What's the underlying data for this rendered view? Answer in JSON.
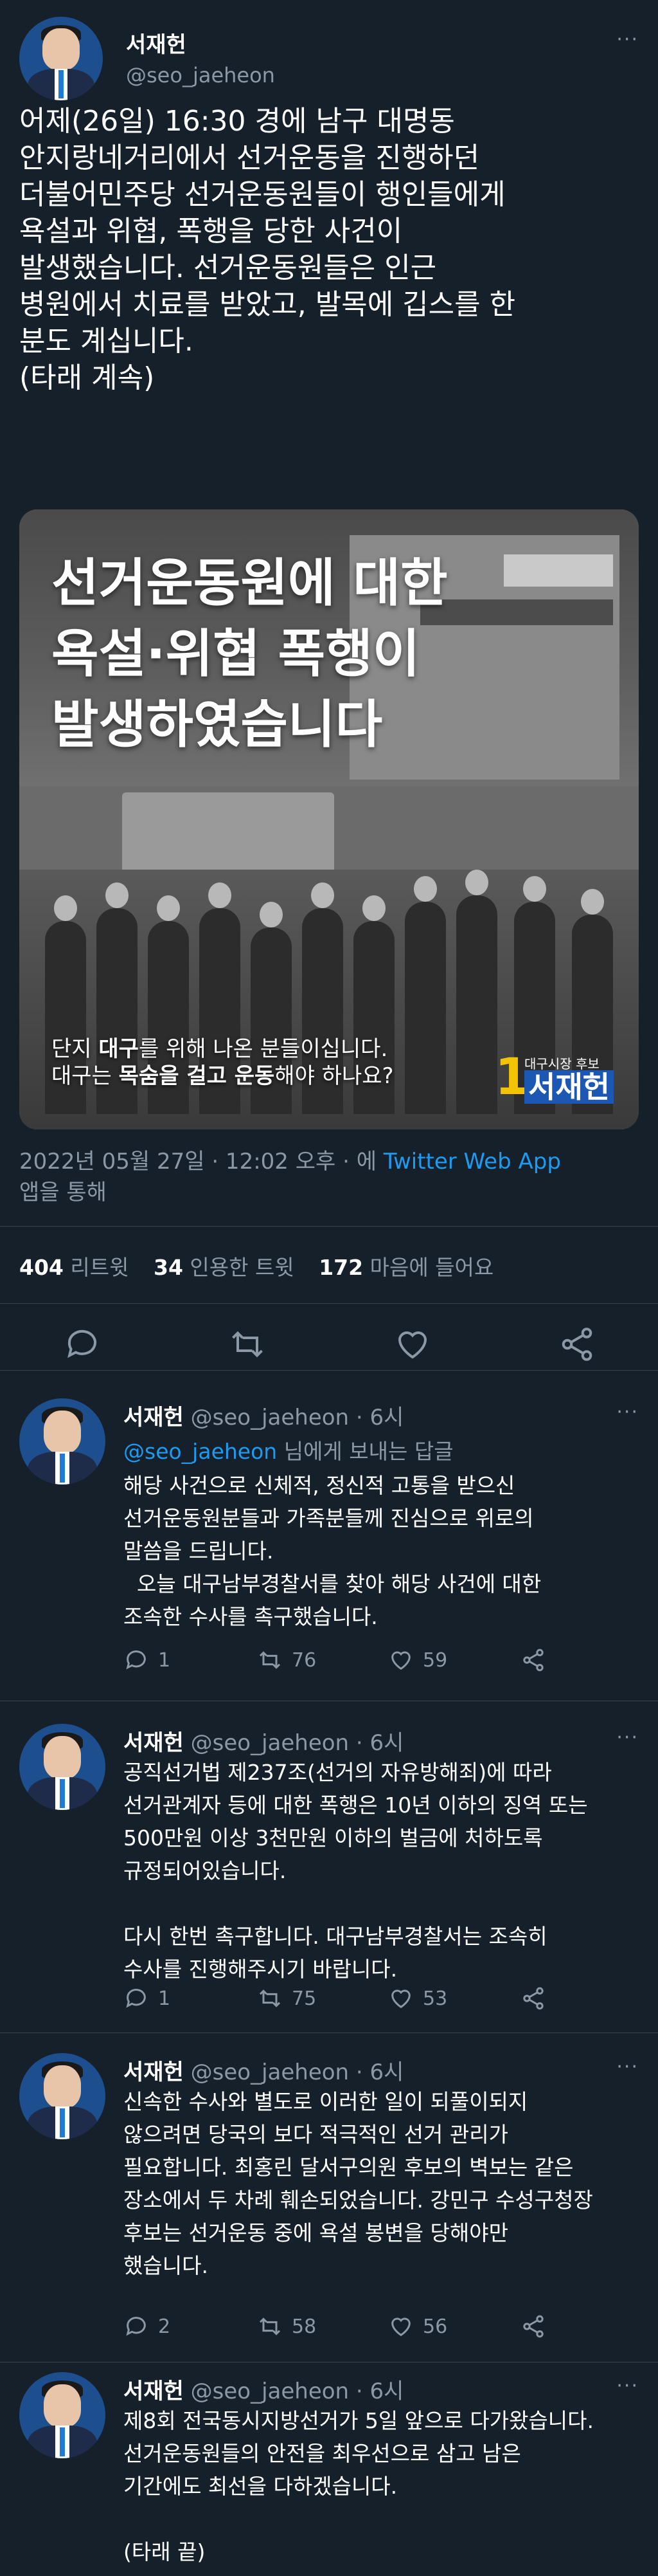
{
  "main_tweet": {
    "name": "서재헌",
    "handle": "@seo_jaeheon",
    "more": "···",
    "text": "어제(26일) 16:30 경에 남구 대명동\n안지랑네거리에서 선거운동을 진행하던\n더불어민주당 선거운동원들이 행인들에게\n욕설과 위협, 폭행을 당한 사건이\n발생했습니다. 선거운동원들은 인근\n병원에서 치료를 받았고, 발목에 깁스를 한\n분도 계십니다.\n(타래 계속)",
    "media": {
      "headline": "선거운동원에 대한\n욕설·위협 폭행이\n발생하였습니다",
      "caption_line1_pre": "단지 ",
      "caption_line1_bold": "대구",
      "caption_line1_post": "를 위해 나온 분들이십니다.",
      "caption_line2_pre": "대구는 ",
      "caption_line2_bold": "목숨을 걸고 운동",
      "caption_line2_post": "해야 하나요?",
      "logo_number": "1",
      "logo_sub": "대구시장 후보",
      "logo_name": "서재헌"
    },
    "meta_date": "2022년 05월 27일 · 12:02 오후 · 에 ",
    "meta_app": "Twitter Web App",
    "meta_suffix": "앱을 통해",
    "stats": {
      "retweets": "404",
      "retweets_label": "리트윗",
      "quotes": "34",
      "quotes_label": "인용한 트윗",
      "likes": "172",
      "likes_label": "마음에 들어요"
    }
  },
  "replies": [
    {
      "name": "서재헌",
      "handle": "@seo_jaeheon · 6시",
      "more": "···",
      "reply_to_handle": "@seo_jaeheon",
      "reply_to_suffix": " 님에게 보내는 답글",
      "text": "해당 사건으로 신체적, 정신적 고통을 받으신\n선거운동원분들과 가족분들께 진심으로 위로의\n말씀을 드립니다.\n  오늘 대구남부경찰서를 찾아 해당 사건에 대한\n조속한 수사를 촉구했습니다.",
      "replies": "1",
      "retweets": "76",
      "likes": "59"
    },
    {
      "name": "서재헌",
      "handle": "@seo_jaeheon · 6시",
      "more": "···",
      "text": "공직선거법 제237조(선거의 자유방해죄)에 따라\n선거관계자 등에 대한 폭행은 10년 이하의 징역 또는\n500만원 이상 3천만원 이하의 벌금에 처하도록\n규정되어있습니다.\n\n다시 한번 촉구합니다. 대구남부경찰서는 조속히\n수사를 진행해주시기 바랍니다.",
      "replies": "1",
      "retweets": "75",
      "likes": "53"
    },
    {
      "name": "서재헌",
      "handle": "@seo_jaeheon · 6시",
      "more": "···",
      "text": "신속한 수사와 별도로 이러한 일이 되풀이되지\n않으려면 당국의 보다 적극적인 선거 관리가\n필요합니다. 최홍린 달서구의원 후보의 벽보는 같은\n장소에서 두 차례 훼손되었습니다. 강민구 수성구청장\n후보는 선거운동 중에 욕설 봉변을 당해야만\n했습니다.",
      "replies": "2",
      "retweets": "58",
      "likes": "56"
    },
    {
      "name": "서재헌",
      "handle": "@seo_jaeheon · 6시",
      "more": "···",
      "text": "제8회 전국동시지방선거가 5일 앞으로 다가왔습니다.\n선거운동원들의 안전을 최우선으로 삼고 남은\n기간에도 최선을 다하겠습니다.\n\n(타래 끝)"
    }
  ],
  "colors": {
    "background": "#15202b",
    "secondary_text": "#8b98a5",
    "link": "#1d9bf0",
    "divider": "#38444d"
  },
  "icons": {
    "reply": "reply-icon",
    "retweet": "retweet-icon",
    "like": "heart-icon",
    "share": "share-icon"
  }
}
